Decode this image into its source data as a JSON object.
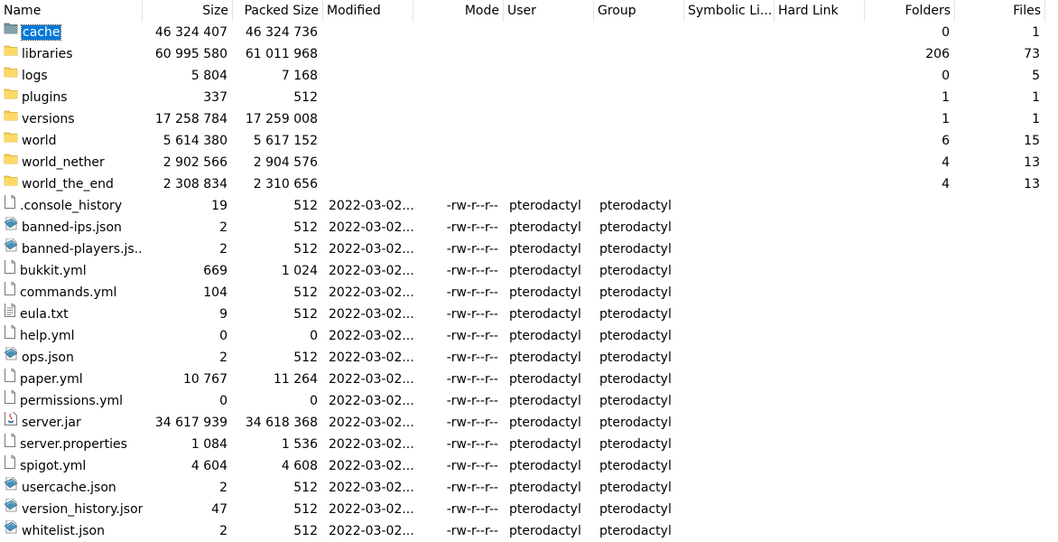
{
  "columns": {
    "name": "Name",
    "size": "Size",
    "packed": "Packed Size",
    "modified": "Modified",
    "mode": "Mode",
    "user": "User",
    "group": "Group",
    "symlink": "Symbolic Li...",
    "hardlink": "Hard Link",
    "folders": "Folders",
    "files": "Files"
  },
  "rows": [
    {
      "name": "cache",
      "icon": "folder-dark-icon",
      "size": "46 324 407",
      "packed": "46 324 736",
      "modified": "",
      "mode": "",
      "user": "",
      "group": "",
      "folders": "0",
      "files": "1",
      "selected": true
    },
    {
      "name": "libraries",
      "icon": "folder-icon",
      "size": "60 995 580",
      "packed": "61 011 968",
      "modified": "",
      "mode": "",
      "user": "",
      "group": "",
      "folders": "206",
      "files": "73"
    },
    {
      "name": "logs",
      "icon": "folder-icon",
      "size": "5 804",
      "packed": "7 168",
      "modified": "",
      "mode": "",
      "user": "",
      "group": "",
      "folders": "0",
      "files": "5"
    },
    {
      "name": "plugins",
      "icon": "folder-icon",
      "size": "337",
      "packed": "512",
      "modified": "",
      "mode": "",
      "user": "",
      "group": "",
      "folders": "1",
      "files": "1"
    },
    {
      "name": "versions",
      "icon": "folder-icon",
      "size": "17 258 784",
      "packed": "17 259 008",
      "modified": "",
      "mode": "",
      "user": "",
      "group": "",
      "folders": "1",
      "files": "1"
    },
    {
      "name": "world",
      "icon": "folder-icon",
      "size": "5 614 380",
      "packed": "5 617 152",
      "modified": "",
      "mode": "",
      "user": "",
      "group": "",
      "folders": "6",
      "files": "15"
    },
    {
      "name": "world_nether",
      "icon": "folder-icon",
      "size": "2 902 566",
      "packed": "2 904 576",
      "modified": "",
      "mode": "",
      "user": "",
      "group": "",
      "folders": "4",
      "files": "13"
    },
    {
      "name": "world_the_end",
      "icon": "folder-icon",
      "size": "2 308 834",
      "packed": "2 310 656",
      "modified": "",
      "mode": "",
      "user": "",
      "group": "",
      "folders": "4",
      "files": "13"
    },
    {
      "name": ".console_history",
      "icon": "file-icon",
      "size": "19",
      "packed": "512",
      "modified": "2022-03-02...",
      "mode": "-rw-r--r--",
      "user": "pterodactyl",
      "group": "pterodactyl",
      "folders": "",
      "files": ""
    },
    {
      "name": "banned-ips.json",
      "icon": "json-file-icon",
      "size": "2",
      "packed": "512",
      "modified": "2022-03-02...",
      "mode": "-rw-r--r--",
      "user": "pterodactyl",
      "group": "pterodactyl",
      "folders": "",
      "files": ""
    },
    {
      "name": "banned-players.js...",
      "icon": "json-file-icon",
      "size": "2",
      "packed": "512",
      "modified": "2022-03-02...",
      "mode": "-rw-r--r--",
      "user": "pterodactyl",
      "group": "pterodactyl",
      "folders": "",
      "files": ""
    },
    {
      "name": "bukkit.yml",
      "icon": "file-icon",
      "size": "669",
      "packed": "1 024",
      "modified": "2022-03-02...",
      "mode": "-rw-r--r--",
      "user": "pterodactyl",
      "group": "pterodactyl",
      "folders": "",
      "files": ""
    },
    {
      "name": "commands.yml",
      "icon": "file-icon",
      "size": "104",
      "packed": "512",
      "modified": "2022-03-02...",
      "mode": "-rw-r--r--",
      "user": "pterodactyl",
      "group": "pterodactyl",
      "folders": "",
      "files": ""
    },
    {
      "name": "eula.txt",
      "icon": "text-file-icon",
      "size": "9",
      "packed": "512",
      "modified": "2022-03-02...",
      "mode": "-rw-r--r--",
      "user": "pterodactyl",
      "group": "pterodactyl",
      "folders": "",
      "files": ""
    },
    {
      "name": "help.yml",
      "icon": "file-icon",
      "size": "0",
      "packed": "0",
      "modified": "2022-03-02...",
      "mode": "-rw-r--r--",
      "user": "pterodactyl",
      "group": "pterodactyl",
      "folders": "",
      "files": ""
    },
    {
      "name": "ops.json",
      "icon": "json-file-icon",
      "size": "2",
      "packed": "512",
      "modified": "2022-03-02...",
      "mode": "-rw-r--r--",
      "user": "pterodactyl",
      "group": "pterodactyl",
      "folders": "",
      "files": ""
    },
    {
      "name": "paper.yml",
      "icon": "file-icon",
      "size": "10 767",
      "packed": "11 264",
      "modified": "2022-03-02...",
      "mode": "-rw-r--r--",
      "user": "pterodactyl",
      "group": "pterodactyl",
      "folders": "",
      "files": ""
    },
    {
      "name": "permissions.yml",
      "icon": "file-icon",
      "size": "0",
      "packed": "0",
      "modified": "2022-03-02...",
      "mode": "-rw-r--r--",
      "user": "pterodactyl",
      "group": "pterodactyl",
      "folders": "",
      "files": ""
    },
    {
      "name": "server.jar",
      "icon": "jar-file-icon",
      "size": "34 617 939",
      "packed": "34 618 368",
      "modified": "2022-03-02...",
      "mode": "-rw-r--r--",
      "user": "pterodactyl",
      "group": "pterodactyl",
      "folders": "",
      "files": ""
    },
    {
      "name": "server.properties",
      "icon": "file-icon",
      "size": "1 084",
      "packed": "1 536",
      "modified": "2022-03-02...",
      "mode": "-rw-r--r--",
      "user": "pterodactyl",
      "group": "pterodactyl",
      "folders": "",
      "files": ""
    },
    {
      "name": "spigot.yml",
      "icon": "file-icon",
      "size": "4 604",
      "packed": "4 608",
      "modified": "2022-03-02...",
      "mode": "-rw-r--r--",
      "user": "pterodactyl",
      "group": "pterodactyl",
      "folders": "",
      "files": ""
    },
    {
      "name": "usercache.json",
      "icon": "json-file-icon",
      "size": "2",
      "packed": "512",
      "modified": "2022-03-02...",
      "mode": "-rw-r--r--",
      "user": "pterodactyl",
      "group": "pterodactyl",
      "folders": "",
      "files": ""
    },
    {
      "name": "version_history.json",
      "icon": "json-file-icon",
      "size": "47",
      "packed": "512",
      "modified": "2022-03-02...",
      "mode": "-rw-r--r--",
      "user": "pterodactyl",
      "group": "pterodactyl",
      "folders": "",
      "files": ""
    },
    {
      "name": "whitelist.json",
      "icon": "json-file-icon",
      "size": "2",
      "packed": "512",
      "modified": "2022-03-02...",
      "mode": "-rw-r--r--",
      "user": "pterodactyl",
      "group": "pterodactyl",
      "folders": "",
      "files": ""
    }
  ],
  "colors": {
    "selection": "#0078d7",
    "folder": "#f5cc55",
    "folder_dark": "#6f8f97",
    "json_file": "#4a90b8"
  }
}
